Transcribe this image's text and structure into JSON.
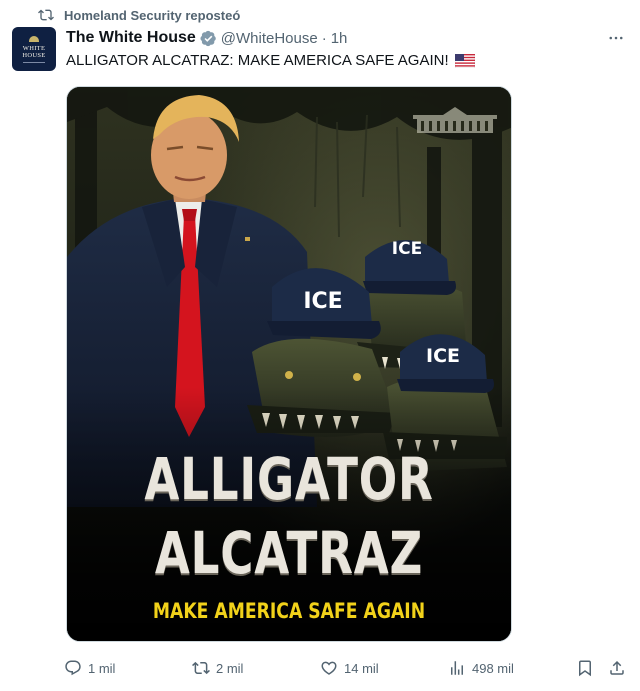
{
  "repost": {
    "label": "Homeland Security reposteó"
  },
  "author": {
    "name": "The White House",
    "handle": "@WhiteHouse",
    "separator": "·",
    "time": "1h",
    "avatar_line1": "WHITE",
    "avatar_line2": "HOUSE"
  },
  "tweet": {
    "text": "ALLIGATOR ALCATRAZ: MAKE AMERICA SAFE AGAIN!"
  },
  "poster": {
    "title_line1": "ALLIGATOR",
    "title_line2": "ALCATRAZ",
    "subtitle": "MAKE AMERICA SAFE AGAIN",
    "cap_label": "ICE"
  },
  "actions": {
    "replies": "1 mil",
    "reposts": "2 mil",
    "likes": "14 mil",
    "views": "498 mil"
  },
  "colors": {
    "secondary_text": "#536471",
    "verified": "#1d9bf0",
    "poster_yellow": "#f2d21a"
  }
}
